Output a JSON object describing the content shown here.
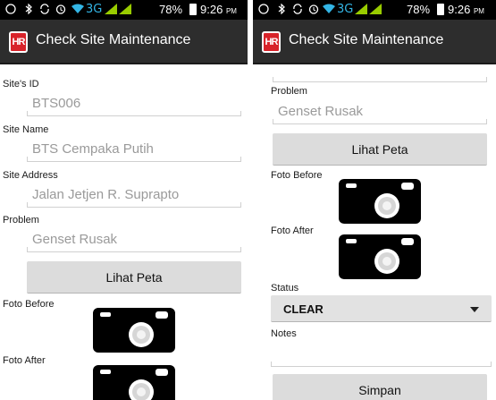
{
  "status_bar": {
    "network": "3G",
    "battery": "78%",
    "time": "9:26",
    "ampm": "PM"
  },
  "app": {
    "icon_text": "HR",
    "title": "Check Site Maintenance"
  },
  "form": {
    "site_id_label": "Site's ID",
    "site_id_value": "BTS006",
    "site_name_label": "Site Name",
    "site_name_value": "BTS Cempaka Putih",
    "site_address_label": "Site Address",
    "site_address_value": "Jalan Jetjen R. Suprapto",
    "problem_label": "Problem",
    "problem_value": "Genset Rusak",
    "lihat_peta_button": "Lihat Peta",
    "foto_before_label": "Foto Before",
    "foto_after_label": "Foto After",
    "status_label": "Status",
    "status_value": "CLEAR",
    "notes_label": "Notes",
    "notes_value": "",
    "simpan_button": "Simpan"
  },
  "colors": {
    "action_bar": "#2d2d2d",
    "status_bar": "#000000",
    "network_accent": "#33b5e5",
    "app_icon": "#d8232a",
    "button": "#dcdcdc"
  },
  "icons": [
    "whatsapp-icon",
    "bluetooth-icon",
    "sync-icon",
    "alarm-icon",
    "wifi-icon",
    "signal-icon",
    "battery-icon",
    "camera-icon",
    "dropdown-arrow-icon"
  ]
}
